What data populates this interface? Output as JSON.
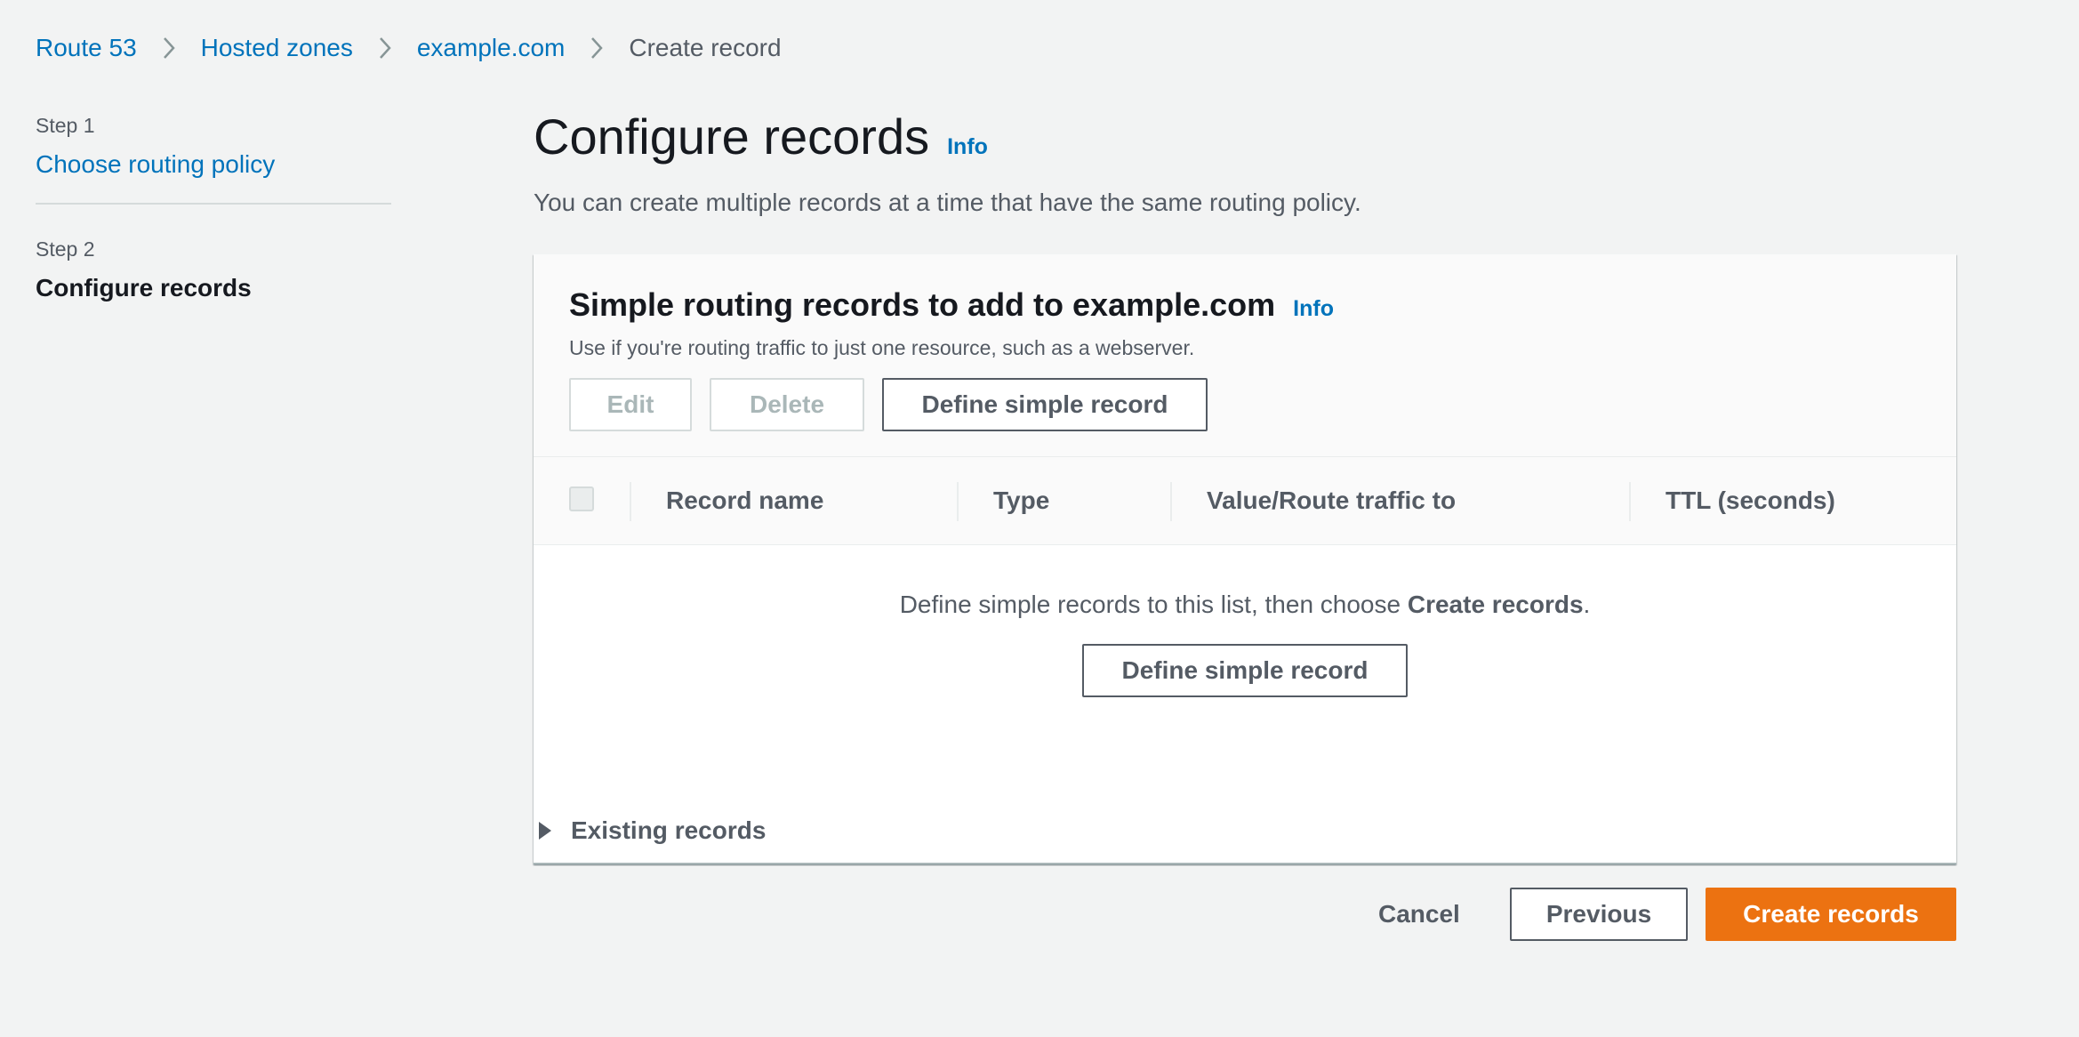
{
  "breadcrumb": {
    "items": [
      "Route 53",
      "Hosted zones",
      "example.com"
    ],
    "current": "Create record"
  },
  "steps": {
    "step1": {
      "label": "Step 1",
      "title": "Choose routing policy"
    },
    "step2": {
      "label": "Step 2",
      "title": "Configure records"
    }
  },
  "page": {
    "title": "Configure records",
    "info": "Info",
    "description": "You can create multiple records at a time that have the same routing policy."
  },
  "panel": {
    "title": "Simple routing records to add to example.com",
    "info": "Info",
    "description": "Use if you're routing traffic to just one resource, such as a webserver.",
    "actions": {
      "edit": "Edit",
      "delete": "Delete",
      "define": "Define simple record"
    },
    "columns": [
      "Record name",
      "Type",
      "Value/Route traffic to",
      "TTL (seconds)"
    ],
    "empty": {
      "text_before": "Define simple records to this list, then choose ",
      "text_bold": "Create records",
      "text_after": ".",
      "button": "Define simple record"
    }
  },
  "existing_records": {
    "label": "Existing records",
    "expanded": false
  },
  "footer": {
    "cancel": "Cancel",
    "previous": "Previous",
    "create": "Create records"
  },
  "colors": {
    "link": "#0073bb",
    "primary_button": "#ec7211",
    "background": "#f2f3f3"
  }
}
